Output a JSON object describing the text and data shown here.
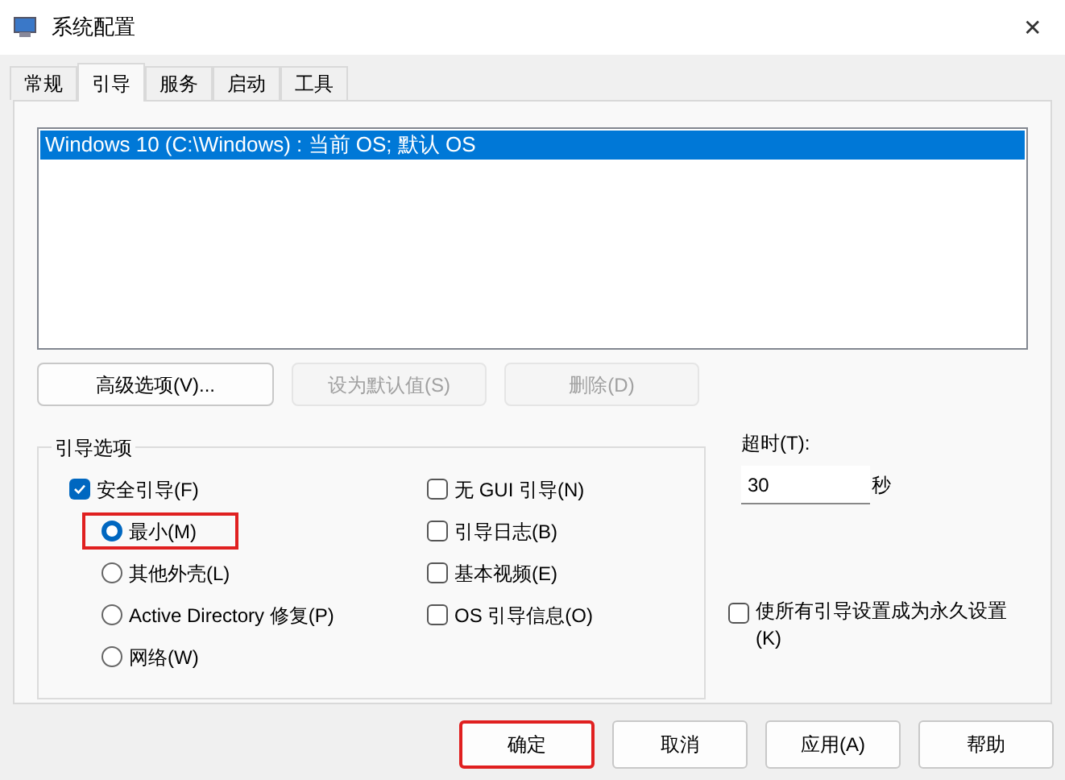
{
  "window": {
    "title": "系统配置",
    "close": "✕"
  },
  "tabs": [
    {
      "label": "常规",
      "selected": false
    },
    {
      "label": "引导",
      "selected": true
    },
    {
      "label": "服务",
      "selected": false
    },
    {
      "label": "启动",
      "selected": false
    },
    {
      "label": "工具",
      "selected": false
    }
  ],
  "boot_list": [
    {
      "label": "Windows 10 (C:\\Windows) : 当前 OS; 默认 OS",
      "selected": true
    }
  ],
  "list_buttons": [
    {
      "label": "高级选项(V)...",
      "disabled": false
    },
    {
      "label": "设为默认值(S)",
      "disabled": true
    },
    {
      "label": "删除(D)",
      "disabled": true
    }
  ],
  "boot_options": {
    "title": "引导选项",
    "left": [
      {
        "kind": "checkbox",
        "label": "安全引导(F)",
        "checked": true,
        "highlighted": false
      },
      {
        "kind": "radio",
        "label": "最小(M)",
        "selected": true,
        "highlighted": true
      },
      {
        "kind": "radio",
        "label": "其他外壳(L)",
        "selected": false,
        "highlighted": false
      },
      {
        "kind": "radio",
        "label": "Active Directory 修复(P)",
        "selected": false,
        "highlighted": false
      },
      {
        "kind": "radio",
        "label": "网络(W)",
        "selected": false,
        "highlighted": false
      }
    ],
    "right": [
      {
        "label": "无 GUI 引导(N)",
        "checked": false
      },
      {
        "label": "引导日志(B)",
        "checked": false
      },
      {
        "label": "基本视频(E)",
        "checked": false
      },
      {
        "label": "OS 引导信息(O)",
        "checked": false
      }
    ]
  },
  "timeout": {
    "label": "超时(T):",
    "value": "30",
    "unit": "秒"
  },
  "permanent": {
    "label": "使所有引导设置成为永久设置 (K)",
    "checked": false
  },
  "buttons": [
    {
      "label": "确定",
      "highlighted": true
    },
    {
      "label": "取消",
      "highlighted": false
    },
    {
      "label": "应用(A)",
      "highlighted": false
    },
    {
      "label": "帮助",
      "highlighted": false
    }
  ]
}
